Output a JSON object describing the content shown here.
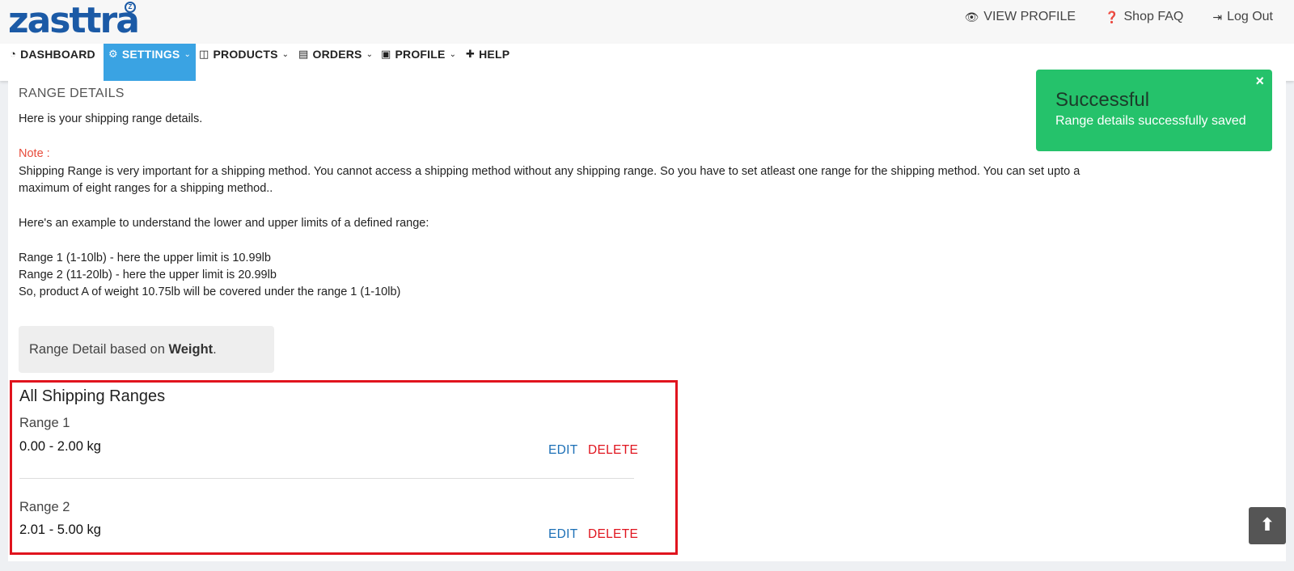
{
  "brand": {
    "logo_text": "zasttra",
    "logo_mark": "Z"
  },
  "header_links": [
    {
      "label": "VIEW PROFILE",
      "icon": "eye-icon"
    },
    {
      "label": "Shop FAQ",
      "icon": "question-circle-icon"
    },
    {
      "label": "Log Out",
      "icon": "sign-out-icon"
    }
  ],
  "nav": [
    {
      "label": "DASHBOARD",
      "icon": "dashboard-icon",
      "active": false,
      "dropdown": false
    },
    {
      "label": "SETTINGS",
      "icon": "gear-icon",
      "active": true,
      "dropdown": true
    },
    {
      "label": "PRODUCTS",
      "icon": "cube-icon",
      "active": false,
      "dropdown": true
    },
    {
      "label": "ORDERS",
      "icon": "clipboard-icon",
      "active": false,
      "dropdown": true
    },
    {
      "label": "PROFILE",
      "icon": "id-card-icon",
      "active": false,
      "dropdown": true
    },
    {
      "label": "HELP",
      "icon": "puzzle-icon",
      "active": false,
      "dropdown": false
    }
  ],
  "main": {
    "section_title": "RANGE DETAILS",
    "intro": "Here is your shipping range details.",
    "note_label": "Note :",
    "note_line1": "Shipping Range is very important for a shipping method. You cannot access a shipping method without any shipping range. So you have to set atleast one range for the shipping method. You can set upto a",
    "note_line2": "maximum of eight ranges for a shipping method..",
    "example_intro": "Here's an example to understand the lower and upper limits of a defined range:",
    "example_1": "Range 1 (1-10lb) - here the upper limit is 10.99lb",
    "example_2": "Range 2 (11-20lb) - here the upper limit is 20.99lb",
    "example_3": "So, product A of weight 10.75lb will be covered under the range 1 (1-10lb)",
    "basis_prefix": "Range Detail based on ",
    "basis_value": "Weight",
    "basis_suffix": "."
  },
  "ranges": {
    "title": "All Shipping Ranges",
    "edit_label": "EDIT",
    "delete_label": "DELETE",
    "items": [
      {
        "name": "Range 1",
        "value": "0.00 - 2.00 kg"
      },
      {
        "name": "Range 2",
        "value": "2.01 - 5.00 kg"
      }
    ]
  },
  "toast": {
    "title": "Successful",
    "message": "Range details successfully saved",
    "close": "×",
    "color": "#25c26b"
  },
  "scroll_top": {
    "icon": "arrow-up-icon"
  },
  "colors": {
    "accent": "#3aa3e3",
    "brand": "#1b5aa6",
    "danger": "#e0141e",
    "link": "#1b6fb6"
  }
}
